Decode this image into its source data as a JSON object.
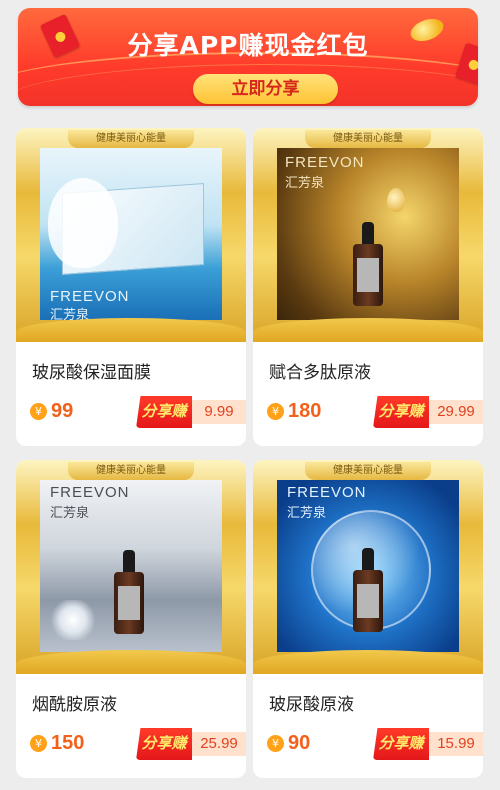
{
  "banner": {
    "title": "分享APP赚现金红包",
    "button_label": "立即分享"
  },
  "products": [
    {
      "tag": "健康美丽心能量",
      "brand_en": "FREEVON",
      "brand_cn": "汇芳泉",
      "name": "玻尿酸保湿面膜",
      "currency": "¥",
      "price": "99",
      "share_label": "分享赚",
      "share_amount": "9.99"
    },
    {
      "tag": "健康美丽心能量",
      "brand_en": "FREEVON",
      "brand_cn": "汇芳泉",
      "name": "赋合多肽原液",
      "currency": "¥",
      "price": "180",
      "share_label": "分享赚",
      "share_amount": "29.99"
    },
    {
      "tag": "健康美丽心能量",
      "brand_en": "FREEVON",
      "brand_cn": "汇芳泉",
      "name": "烟酰胺原液",
      "currency": "¥",
      "price": "150",
      "share_label": "分享赚",
      "share_amount": "25.99"
    },
    {
      "tag": "健康美丽心能量",
      "brand_en": "FREEVON",
      "brand_cn": "汇芳泉",
      "name": "玻尿酸原液",
      "currency": "¥",
      "price": "90",
      "share_label": "分享赚",
      "share_amount": "15.99"
    }
  ],
  "colors": {
    "banner": "#ff3b2b",
    "price": "#f2611b",
    "share_button": "#e4171a",
    "frame_gold": "#e8b93a"
  }
}
